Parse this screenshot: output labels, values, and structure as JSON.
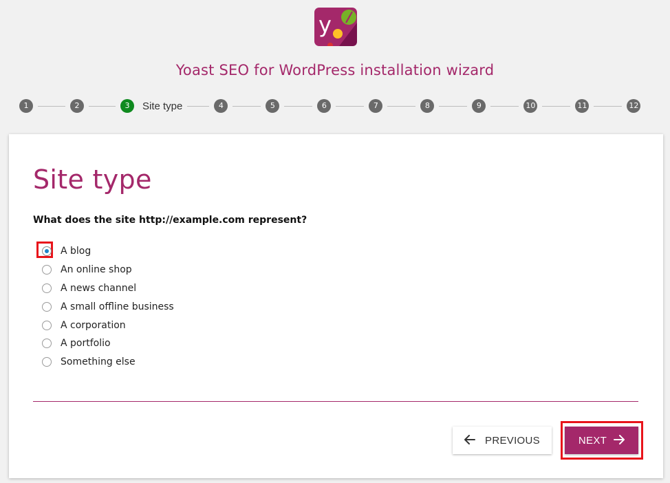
{
  "wizard": {
    "title": "Yoast SEO for WordPress installation wizard"
  },
  "stepper": {
    "steps": [
      {
        "number": "1"
      },
      {
        "number": "2"
      },
      {
        "number": "3",
        "label": "Site type",
        "active": true
      },
      {
        "number": "4"
      },
      {
        "number": "5"
      },
      {
        "number": "6"
      },
      {
        "number": "7"
      },
      {
        "number": "8"
      },
      {
        "number": "9"
      },
      {
        "number": "10"
      },
      {
        "number": "11"
      },
      {
        "number": "12"
      }
    ]
  },
  "card": {
    "title": "Site type",
    "question": "What does the site http://example.com represent?",
    "options": [
      {
        "label": "A blog",
        "checked": true
      },
      {
        "label": "An online shop",
        "checked": false
      },
      {
        "label": "A news channel",
        "checked": false
      },
      {
        "label": "A small offline business",
        "checked": false
      },
      {
        "label": "A corporation",
        "checked": false
      },
      {
        "label": "A portfolio",
        "checked": false
      },
      {
        "label": "Something else",
        "checked": false
      }
    ]
  },
  "buttons": {
    "previous": "PREVIOUS",
    "next": "NEXT"
  },
  "colors": {
    "brand": "#a4286a",
    "active_step": "#0f8a1f",
    "step": "#6a6a6a",
    "radio_dot": "#1e84c8",
    "highlight": "#e8141b"
  },
  "icons": {
    "logo": "yoast-logo-icon",
    "previous": "arrow-left-icon",
    "next": "arrow-right-icon"
  }
}
